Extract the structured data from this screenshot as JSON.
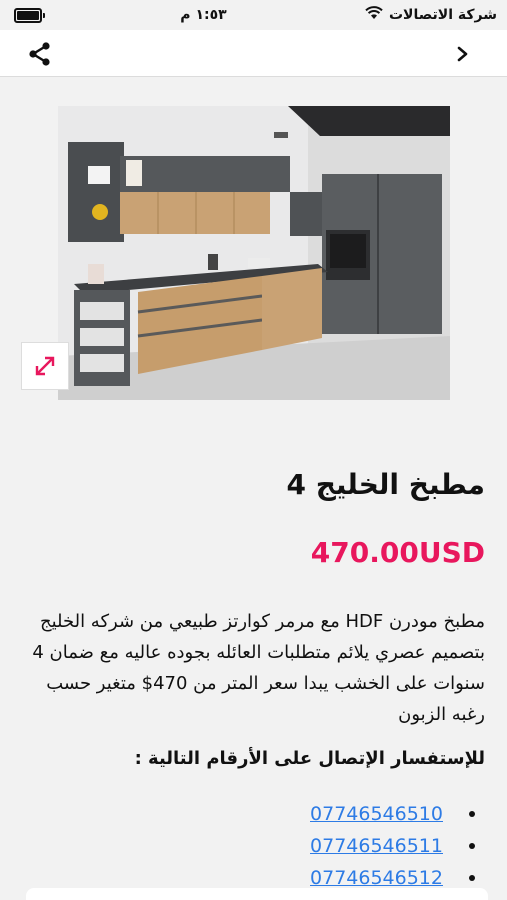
{
  "status_bar": {
    "carrier": "شركة الاتصالات",
    "time": "١:٥٣ م"
  },
  "top_bar": {
    "share_icon": "share-icon",
    "back_icon": "chevron-right-icon"
  },
  "product": {
    "title": "مطبخ الخليج 4",
    "price": "470.00USD",
    "description": "مطبخ مودرن HDF مع مرمر كوارتز طبيعي من شركه الخليج بتصميم عصري يلائم متطلبات العائله بجوده عاليه مع ضمان 4 سنوات على الخشب يبدا سعر المتر من 470$ متغير حسب رغبه الزبون",
    "inquiry_label": "للإستفسار الإتصال على الأرقام التالية :",
    "phones": [
      "07746546510",
      "07746546511",
      "07746546512"
    ]
  },
  "colors": {
    "price": "#e8175d",
    "link": "#2d7be5",
    "expand_icon": "#e8175d"
  }
}
